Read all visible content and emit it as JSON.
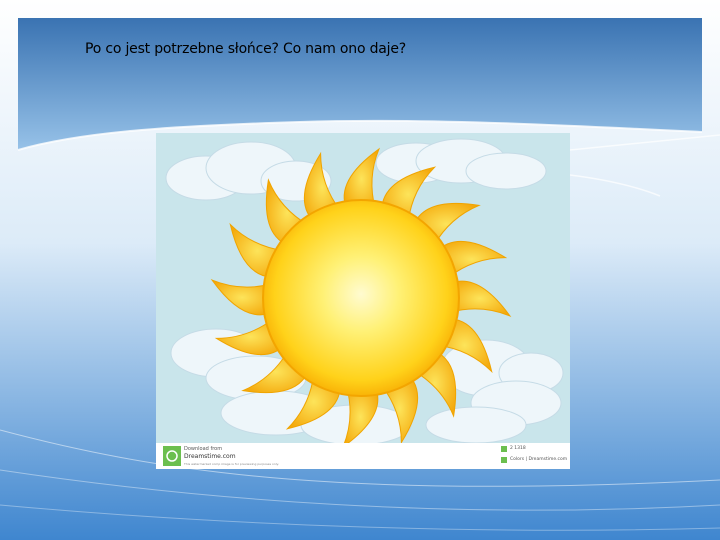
{
  "slide": {
    "title": "Po co jest potrzebne słońce? Co nam ono daje?"
  },
  "image": {
    "watermark": {
      "download_from": "Download from",
      "site": "Dreamstime.com",
      "footnote": "This watermarked comp image is for previewing purposes only.",
      "id_text": "2 1318",
      "credit": "Colors | Dreamstime.com"
    }
  },
  "colors": {
    "banner_top": "#3f7ab8",
    "banner_bottom": "#8ab8e2",
    "sky_bg": "#c8e4ea",
    "sun_core": "#fff7a0",
    "sun_edge": "#f5b400",
    "ray": "#f6c81c",
    "cloud": "#eef6fa"
  }
}
